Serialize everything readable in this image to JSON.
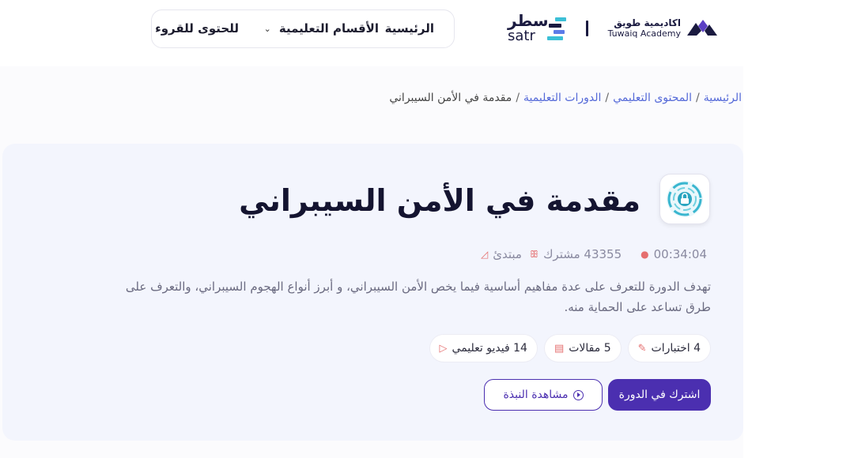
{
  "header": {
    "logo_satr_ar": "سطر",
    "logo_satr_en": "satr",
    "logo_tuwaiq_ar": "اكاديمية طويق",
    "logo_tuwaiq_en": "Tuwaiq Academy",
    "nav": {
      "home": "الرئيسية",
      "sections": "الأقسام التعليمية",
      "reading": "للحتوى للقروء"
    },
    "satr_colors": [
      "#1a1a40",
      "#3bbfd6",
      "#5b7be8"
    ]
  },
  "breadcrumb": {
    "items": [
      "الرئيسية",
      "المحتوى التعليمي",
      "الدورات التعليمية"
    ],
    "current": "مقدمة في الأمن السيبراني",
    "separator": "/"
  },
  "course": {
    "icon": "cyber-lock-icon",
    "title": "مقدمة في الأمن السيبراني",
    "level": "مبتدئ",
    "participants": "43355 مشترك",
    "duration": "00:34:04",
    "description": "تهدف الدورة للتعرف على عدة مفاهيم أساسية فيما يخص الأمن السيبراني، و أبرز أنواع الهجوم السيبراني، والتعرف على طرق تساعد على الحماية منه.",
    "chips": {
      "videos": "14 فيديو تعليمي",
      "articles": "5 مقالات",
      "quizzes": "4 اختبارات"
    },
    "buttons": {
      "subscribe": "اشترك في الدورة",
      "preview": "مشاهدة النبذة"
    }
  },
  "colors": {
    "primary": "#4b2fb0",
    "link": "#5469d8",
    "accent": "#e56f6f",
    "card_bg": "#f3f5fd"
  }
}
